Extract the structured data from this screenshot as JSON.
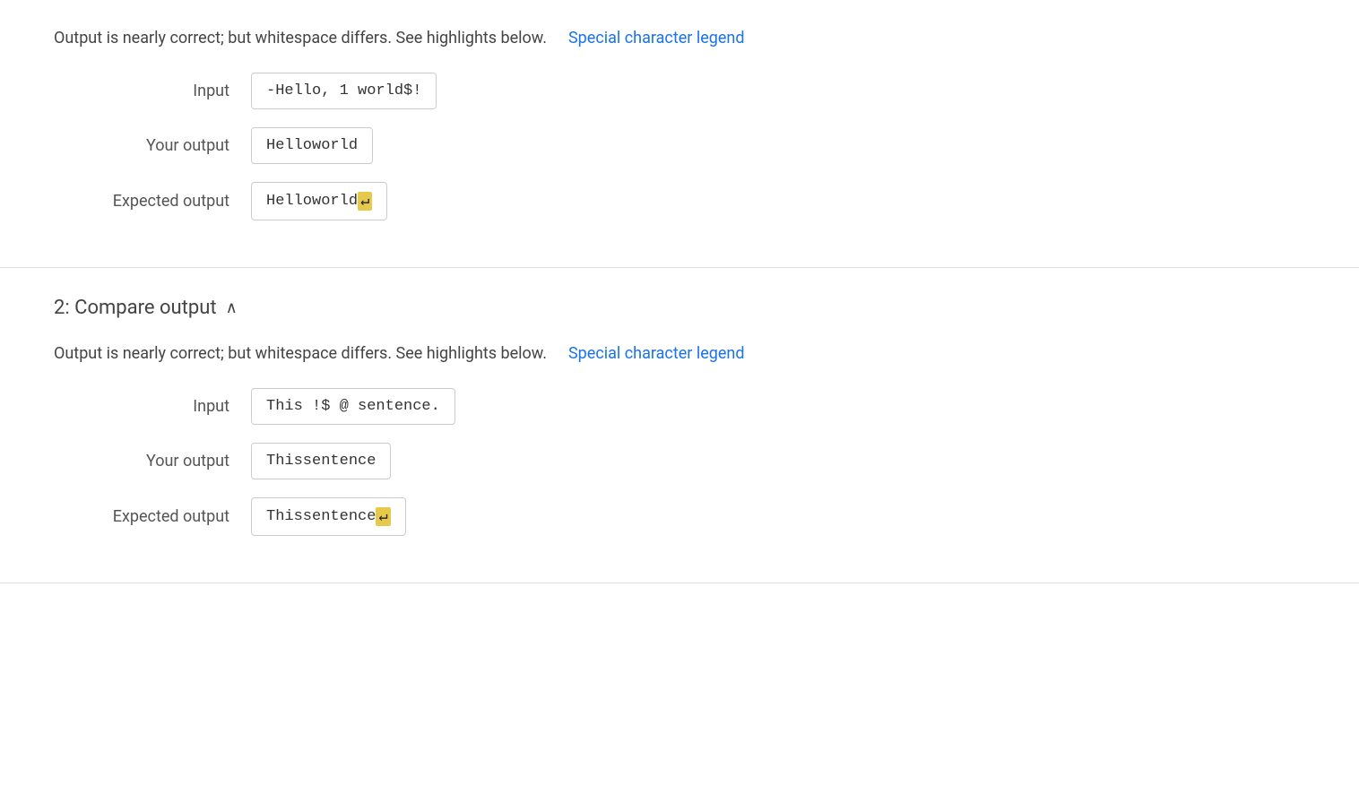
{
  "section1": {
    "status_text": "Output is nearly correct; but whitespace differs. See highlights below.",
    "special_legend_label": "Special character legend",
    "input_label": "Input",
    "input_value": "-Hello, 1 world$!",
    "your_output_label": "Your output",
    "your_output_value": "Helloworld",
    "expected_output_label": "Expected output",
    "expected_output_value": "Helloworld",
    "expected_newline_symbol": "↵"
  },
  "section2": {
    "header_label": "2: Compare output",
    "chevron": "∧",
    "status_text": "Output is nearly correct; but whitespace differs. See highlights below.",
    "special_legend_label": "Special character legend",
    "input_label": "Input",
    "input_value": "This !$ @ sentence.",
    "your_output_label": "Your output",
    "your_output_value": "Thissentence",
    "expected_output_label": "Expected output",
    "expected_output_value": "Thissentence",
    "expected_newline_symbol": "↵"
  }
}
